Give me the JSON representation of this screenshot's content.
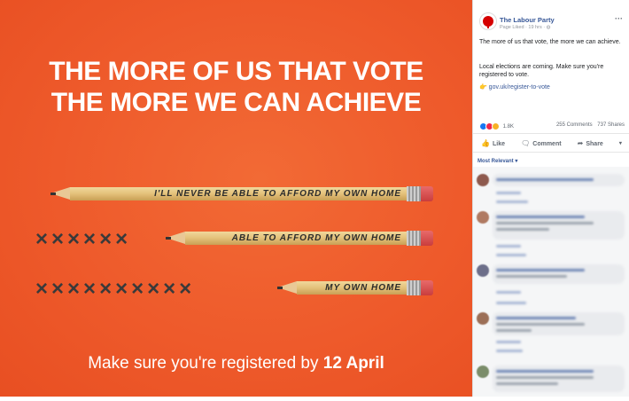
{
  "poster": {
    "headline_line1": "THE MORE OF US THAT VOTE",
    "headline_line2": "THE MORE WE CAN ACHIEVE",
    "pencils": [
      {
        "text": "I'LL NEVER BE ABLE TO AFFORD MY OWN HOME",
        "crosses": ""
      },
      {
        "text": "ABLE TO AFFORD MY OWN HOME",
        "crosses": "××××××"
      },
      {
        "text": "MY OWN HOME",
        "crosses": "××××××××××"
      }
    ],
    "footer_text": "Make sure you're registered by ",
    "footer_date": "12 April",
    "colors": {
      "background": "#ee5a2b",
      "text": "#ffffff"
    }
  },
  "facebook_post": {
    "page_name": "The Labour Party",
    "meta": "Page Liked · 19 hrs ·",
    "more_icon": "···",
    "paragraph1": "The more of us that vote, the more we can achieve.",
    "paragraph2": "Local elections are coming. Make sure you're registered to vote.",
    "link_emoji": "👉",
    "link_text": "gov.uk/register-to-vote",
    "reaction_count": "1.8K",
    "comments_count": "255 Comments",
    "shares_count": "737 Shares",
    "actions": {
      "like": "Like",
      "comment": "Comment",
      "share": "Share"
    },
    "sort_label": "Most Relevant ▾",
    "colors": {
      "link": "#385898",
      "brand_red": "#d50000"
    }
  }
}
